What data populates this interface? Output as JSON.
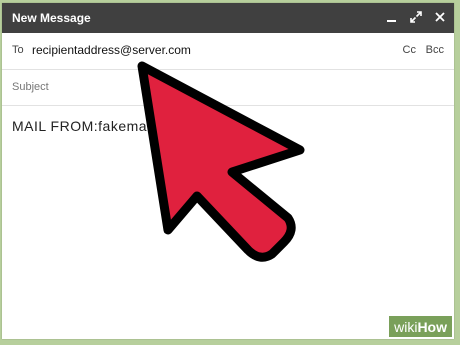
{
  "window": {
    "title": "New Message",
    "controls": [
      "minimize-icon",
      "expand-icon",
      "close-icon"
    ]
  },
  "compose": {
    "to_label": "To",
    "to_value": "recipientaddress@server.com",
    "cc_label": "Cc",
    "bcc_label": "Bcc",
    "subject_placeholder": "Subject",
    "body_text": "MAIL FROM:fakema"
  },
  "watermark": {
    "prefix": "wiki",
    "suffix": "How"
  },
  "colors": {
    "background": "#b7cf9c",
    "titlebar": "#404040",
    "arrow_fill": "#e0213e",
    "arrow_stroke": "#000000",
    "watermark": "#7aa05a"
  }
}
